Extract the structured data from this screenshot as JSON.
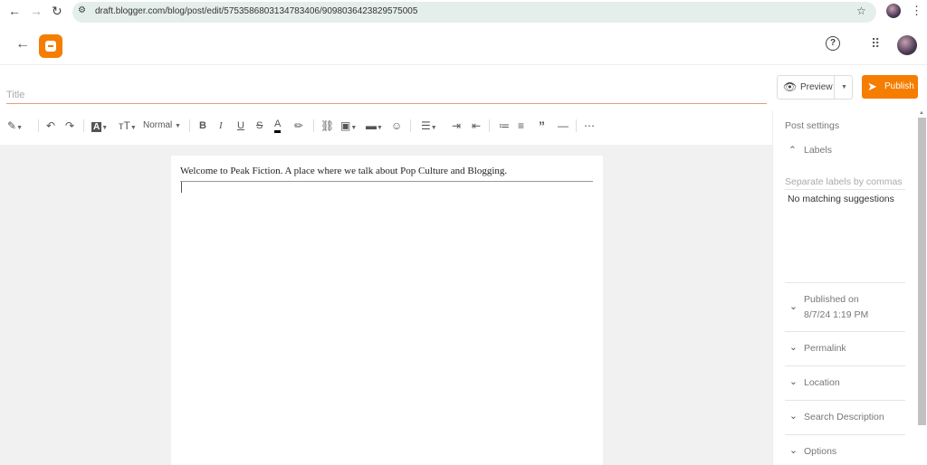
{
  "browser": {
    "url": "draft.blogger.com/blog/post/edit/5753586803134783406/9098036423829575005"
  },
  "editor": {
    "title_placeholder": "Title",
    "paragraph_style": "Normal",
    "body_text": "Welcome to Peak Fiction. A place where we talk about Pop Culture and Blogging."
  },
  "actions": {
    "preview": "Preview",
    "publish": "Publish"
  },
  "sidebar": {
    "heading": "Post settings",
    "labels": {
      "title": "Labels",
      "placeholder": "Separate labels by commas",
      "suggestion": "No matching suggestions"
    },
    "published_label": "Published on",
    "published_date": "8/7/24 1:19 PM",
    "items": [
      {
        "label": "Permalink"
      },
      {
        "label": "Location"
      },
      {
        "label": "Search Description"
      },
      {
        "label": "Options"
      }
    ]
  },
  "colors": {
    "accent": "#f57d00"
  }
}
